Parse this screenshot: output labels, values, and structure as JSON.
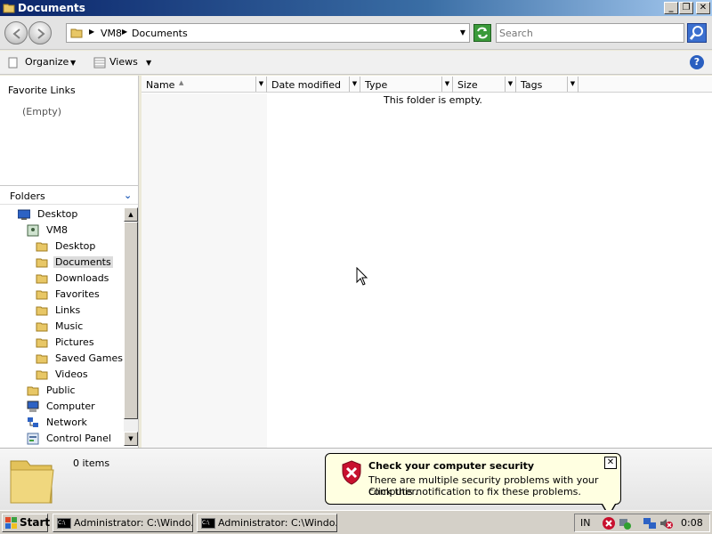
{
  "window": {
    "title": "Documents"
  },
  "window_controls": {
    "minimize": "_",
    "restore": "❐",
    "close": "✕"
  },
  "address": {
    "crumbs": [
      "VM8",
      "Documents"
    ]
  },
  "search": {
    "placeholder": "Search"
  },
  "toolbar": {
    "organize_label": "Organize",
    "views_label": "Views",
    "help_label": "?"
  },
  "favorites": {
    "header": "Favorite Links",
    "empty_label": "(Empty)"
  },
  "folders_pane": {
    "header": "Folders"
  },
  "tree": [
    {
      "label": "Desktop",
      "icon": "desktop-icon"
    },
    {
      "label": "VM8",
      "icon": "user-folder-icon"
    },
    {
      "label": "Desktop",
      "icon": "folder-icon"
    },
    {
      "label": "Documents",
      "icon": "folder-icon",
      "selected": true
    },
    {
      "label": "Downloads",
      "icon": "folder-icon"
    },
    {
      "label": "Favorites",
      "icon": "folder-icon"
    },
    {
      "label": "Links",
      "icon": "folder-icon"
    },
    {
      "label": "Music",
      "icon": "folder-icon"
    },
    {
      "label": "Pictures",
      "icon": "folder-icon"
    },
    {
      "label": "Saved Games",
      "icon": "folder-icon"
    },
    {
      "label": "Videos",
      "icon": "folder-icon"
    },
    {
      "label": "Public",
      "icon": "folder-icon"
    },
    {
      "label": "Computer",
      "icon": "computer-icon"
    },
    {
      "label": "Network",
      "icon": "network-icon"
    },
    {
      "label": "Control Panel",
      "icon": "control-panel-icon"
    }
  ],
  "columns": [
    "Name",
    "Date modified",
    "Type",
    "Size",
    "Tags"
  ],
  "content": {
    "empty_message": "This folder is empty."
  },
  "details": {
    "item_count": "0 items"
  },
  "notification": {
    "title": "Check your computer security",
    "line1": "There are multiple security problems with your computer.",
    "line2": "Click this notification to fix these problems.",
    "close_label": "✕"
  },
  "taskbar": {
    "start_label": "Start",
    "tasks": [
      "Administrator: C:\\Windo...",
      "Administrator: C:\\Windo..."
    ],
    "language": "IN",
    "clock": "0:08"
  },
  "colors": {
    "title_gradient_start": "#0a246a",
    "accent_blue": "#1e5bb8",
    "balloon_bg": "#ffffe1",
    "security_red": "#c8102e"
  }
}
